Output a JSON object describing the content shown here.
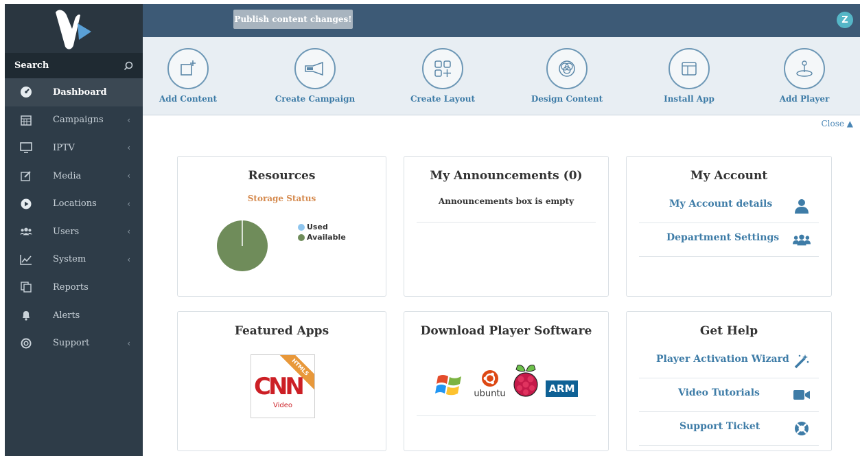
{
  "topbar": {
    "publish_label": "Publish content changes!",
    "user_initial": "Z"
  },
  "sidebar": {
    "search_label": "Search",
    "items": [
      {
        "label": "Dashboard",
        "icon": "dashboard-icon",
        "active": true,
        "has_submenu": false
      },
      {
        "label": "Campaigns",
        "icon": "calendar-icon",
        "has_submenu": true
      },
      {
        "label": "IPTV",
        "icon": "monitor-icon",
        "has_submenu": true
      },
      {
        "label": "Media",
        "icon": "edit-icon",
        "has_submenu": true
      },
      {
        "label": "Locations",
        "icon": "play-circle-icon",
        "has_submenu": true
      },
      {
        "label": "Users",
        "icon": "users-icon",
        "has_submenu": true
      },
      {
        "label": "System",
        "icon": "line-chart-icon",
        "has_submenu": true
      },
      {
        "label": "Reports",
        "icon": "copy-icon",
        "has_submenu": false
      },
      {
        "label": "Alerts",
        "icon": "bell-icon",
        "has_submenu": false
      },
      {
        "label": "Support",
        "icon": "life-ring-icon",
        "has_submenu": true
      }
    ],
    "chevron": "‹"
  },
  "quick_actions": [
    {
      "label": "Add Content",
      "icon": "add-content-icon"
    },
    {
      "label": "Create Campaign",
      "icon": "megaphone-icon"
    },
    {
      "label": "Create Layout",
      "icon": "layout-grid-icon"
    },
    {
      "label": "Design Content",
      "icon": "design-circles-icon"
    },
    {
      "label": "Install App",
      "icon": "app-window-icon"
    },
    {
      "label": "Add Player",
      "icon": "joystick-icon"
    }
  ],
  "close_label": "Close ▲",
  "resources": {
    "title": "Resources",
    "storage_label": "Storage Status",
    "legend_used": "Used",
    "legend_available": "Available",
    "used_fraction": 0.002,
    "colors": {
      "used": "#8ec5ee",
      "available": "#6f8c5a"
    }
  },
  "announcements": {
    "title": "My Announcements (0)",
    "empty_text": "Announcements box is empty"
  },
  "account": {
    "title": "My Account",
    "links": [
      {
        "label": "My Account details",
        "icon": "user-icon"
      },
      {
        "label": "Department Settings",
        "icon": "users-icon"
      }
    ]
  },
  "featured_apps": {
    "title": "Featured Apps",
    "app_ribbon": "HTML5",
    "app_sub": "Video",
    "app_logo": "CNN"
  },
  "download": {
    "title": "Download Player Software",
    "platforms": [
      "windows-logo-icon",
      "ubuntu",
      "raspberry-pi-logo-icon",
      "ARM"
    ]
  },
  "help": {
    "title": "Get Help",
    "links": [
      {
        "label": "Player Activation Wizard",
        "icon": "magic-wand-icon"
      },
      {
        "label": "Video Tutorials",
        "icon": "video-camera-icon"
      },
      {
        "label": "Support Ticket",
        "icon": "life-ring-icon"
      }
    ]
  }
}
